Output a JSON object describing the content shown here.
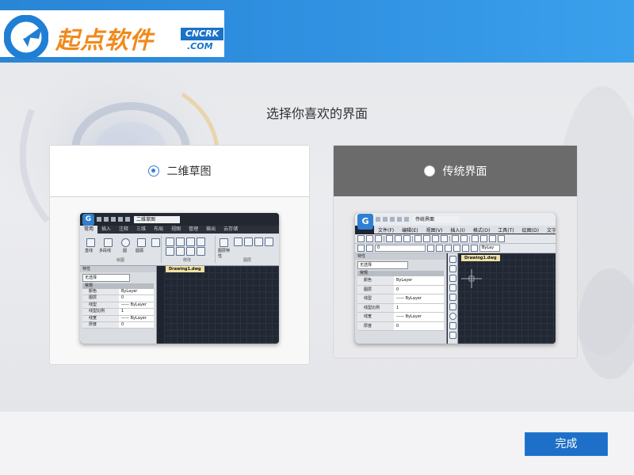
{
  "brand": {
    "logo_text": "起点软件",
    "badge_top": "CNCRK",
    "badge_bottom": ".COM",
    "accent_color": "#2f8fe0",
    "logo_text_color": "#f08a1c"
  },
  "heading": "选择你喜欢的界面",
  "options": [
    {
      "label": "二维草图",
      "selected": true,
      "preview": {
        "title": "二维草图",
        "ribbon_tabs": [
          "常用",
          "插入",
          "注释",
          "三维",
          "布局",
          "视图",
          "管理",
          "输出",
          "云存储"
        ],
        "ribbon_tools": [
          "直线",
          "多段线",
          "圆",
          "圆弧"
        ],
        "group_names": [
          "绘图",
          "修改",
          "图层"
        ],
        "layer_label": "图层特性",
        "doc_tab": "Drawing1.dwg",
        "panel_title": "特性",
        "selection": "无选择",
        "section": "常规",
        "properties": [
          {
            "key": "颜色",
            "value": "ByLayer"
          },
          {
            "key": "图层",
            "value": "0"
          },
          {
            "key": "线型",
            "value": "—— ByLayer"
          },
          {
            "key": "线型比例",
            "value": "1"
          },
          {
            "key": "线宽",
            "value": "—— ByLayer"
          },
          {
            "key": "厚度",
            "value": "0"
          }
        ]
      }
    },
    {
      "label": "传统界面",
      "selected": false,
      "preview": {
        "title": "传统界面",
        "menus": [
          "文件(F)",
          "编辑(E)",
          "视图(V)",
          "插入(I)",
          "格式(O)",
          "工具(T)",
          "绘图(D)",
          "文字(X"
        ],
        "layer_field": "0",
        "bylayer_field": "ByLay",
        "doc_tab": "Drawing1.dwg",
        "panel_title": "特性",
        "selection": "无选择",
        "section": "常规",
        "properties": [
          {
            "key": "颜色",
            "value": "ByLayer"
          },
          {
            "key": "图层",
            "value": "0"
          },
          {
            "key": "线型",
            "value": "—— ByLayer"
          },
          {
            "key": "线型比例",
            "value": "1"
          },
          {
            "key": "线宽",
            "value": "—— ByLayer"
          },
          {
            "key": "厚度",
            "value": "0"
          }
        ]
      }
    }
  ],
  "done_button": "完成"
}
